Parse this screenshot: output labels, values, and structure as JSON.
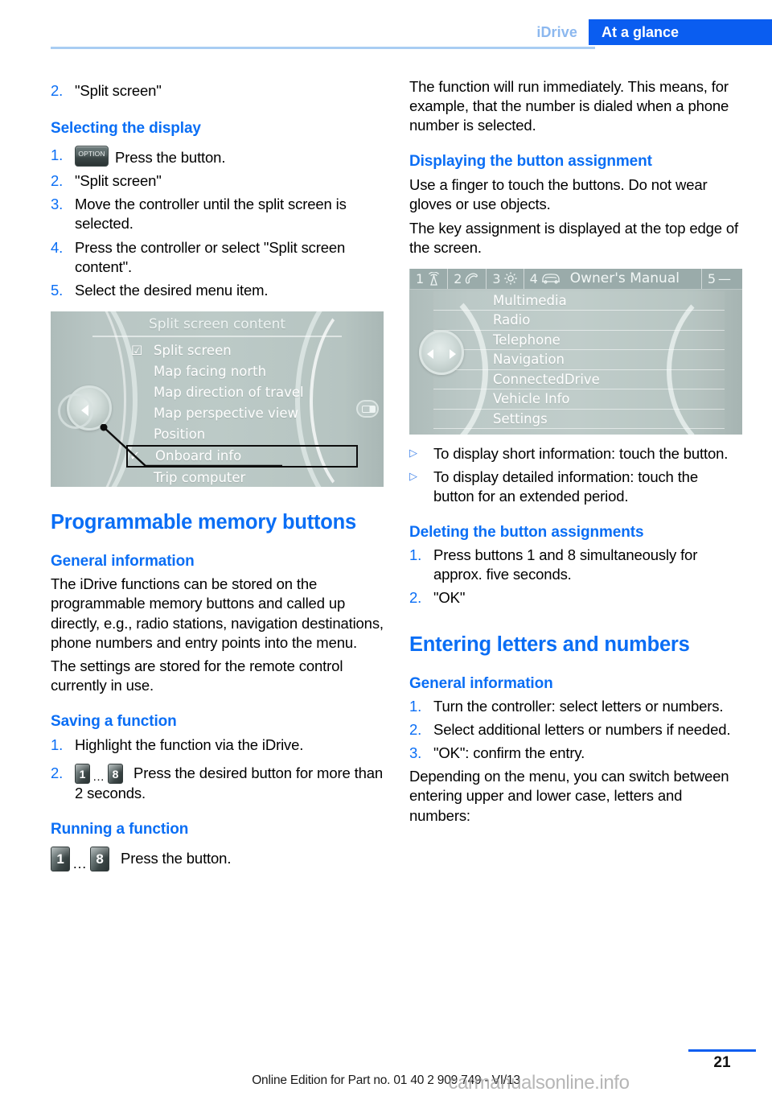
{
  "header": {
    "chapter": "iDrive",
    "section": "At a glance"
  },
  "left_column": {
    "lead_step": {
      "num": "2.",
      "text": "\"Split screen\""
    },
    "selecting_display": {
      "heading": "Selecting the display",
      "steps": [
        {
          "num": "1.",
          "icon": "option-hardkey-icon",
          "icon_label": "OPTION",
          "text": "Press the button."
        },
        {
          "num": "2.",
          "text": "\"Split screen\""
        },
        {
          "num": "3.",
          "text": "Move the controller until the split screen is selected."
        },
        {
          "num": "4.",
          "text": "Press the controller or select \"Split screen content\"."
        },
        {
          "num": "5.",
          "text": "Select the desired menu item."
        }
      ]
    },
    "split_screen_image": {
      "title": "Split screen content",
      "items": [
        {
          "label": "Split screen",
          "mark": "checkbox",
          "selected": false
        },
        {
          "label": "Map facing north",
          "mark": "none",
          "selected": false
        },
        {
          "label": "Map direction of travel",
          "mark": "none",
          "selected": false
        },
        {
          "label": "Map perspective view",
          "mark": "none",
          "selected": false
        },
        {
          "label": "Position",
          "mark": "none",
          "selected": false
        },
        {
          "label": "Onboard info",
          "mark": "check",
          "selected": true
        },
        {
          "label": "Trip computer",
          "mark": "none",
          "selected": false
        }
      ]
    },
    "programmable_memory": {
      "heading": "Programmable memory buttons",
      "general_heading": "General information",
      "paragraphs": [
        "The iDrive functions can be stored on the programmable memory buttons and called up directly, e.g., radio stations, navigation destinations, phone numbers and entry points into the menu.",
        "The settings are stored for the remote control currently in use."
      ]
    },
    "saving": {
      "heading": "Saving a function",
      "steps": [
        {
          "num": "1.",
          "text": "Highlight the function via the iDrive."
        },
        {
          "num": "2.",
          "icon": "memory-buttons-1-to-8-icon",
          "key_first": "1",
          "key_dots": "…",
          "key_last": "8",
          "text": "Press the desired button for more than 2 seconds."
        }
      ]
    },
    "running": {
      "heading": "Running a function",
      "icon": "memory-buttons-1-to-8-icon",
      "key_first": "1",
      "key_dots": "…",
      "key_last": "8",
      "text": "Press the button."
    }
  },
  "right_column": {
    "intro_paragraph": "The function will run immediately. This means, for example, that the number is dialed when a phone number is selected.",
    "displaying_assignment": {
      "heading": "Displaying the button assignment",
      "paragraphs": [
        "Use a finger to touch the buttons. Do not wear gloves or use objects.",
        "The key assignment is displayed at the top edge of the screen."
      ]
    },
    "owners_manual_image": {
      "bar": [
        {
          "num": "1",
          "icon": "radio-tower-icon"
        },
        {
          "num": "2",
          "icon": "telephone-handset-icon"
        },
        {
          "num": "3",
          "icon": "gear-icon"
        },
        {
          "num": "4",
          "icon": "car-front-icon",
          "title": "Owner's Manual"
        },
        {
          "num": "5",
          "icon": "dash-icon",
          "dash": "—"
        }
      ],
      "menu_items": [
        "Multimedia",
        "Radio",
        "Telephone",
        "Navigation",
        "ConnectedDrive",
        "Vehicle Info",
        "Settings"
      ]
    },
    "touch_bullets": [
      {
        "bullet": "▷",
        "text": "To display short information: touch the button."
      },
      {
        "bullet": "▷",
        "text": "To display detailed information: touch the button for an extended period."
      }
    ],
    "deleting": {
      "heading": "Deleting the button assignments",
      "steps": [
        {
          "num": "1.",
          "text": "Press buttons 1 and 8 simultaneously for approx. five seconds."
        },
        {
          "num": "2.",
          "text": "\"OK\""
        }
      ]
    },
    "entering": {
      "heading": "Entering letters and numbers",
      "general_heading": "General information",
      "steps": [
        {
          "num": "1.",
          "text": "Turn the controller: select letters or numbers."
        },
        {
          "num": "2.",
          "text": "Select additional letters or numbers if needed."
        },
        {
          "num": "3.",
          "text": "\"OK\": confirm the entry."
        }
      ],
      "closing_paragraph": "Depending on the menu, you can switch between entering upper and lower case, letters and numbers:"
    }
  },
  "footer": {
    "page_number": "21",
    "edition_line": "Online Edition for Part no. 01 40 2 909 749 - VI/13",
    "watermark": "carmanualsonline.info"
  },
  "colors": {
    "accent_blue": "#0a6ef5",
    "tab_blue": "#0a5df0",
    "chapter_blue": "#8cb8ef",
    "rule_blue": "#a9cdf3",
    "screen_bg": "#b7c4c2",
    "screen_bar": "#9aabaa"
  }
}
